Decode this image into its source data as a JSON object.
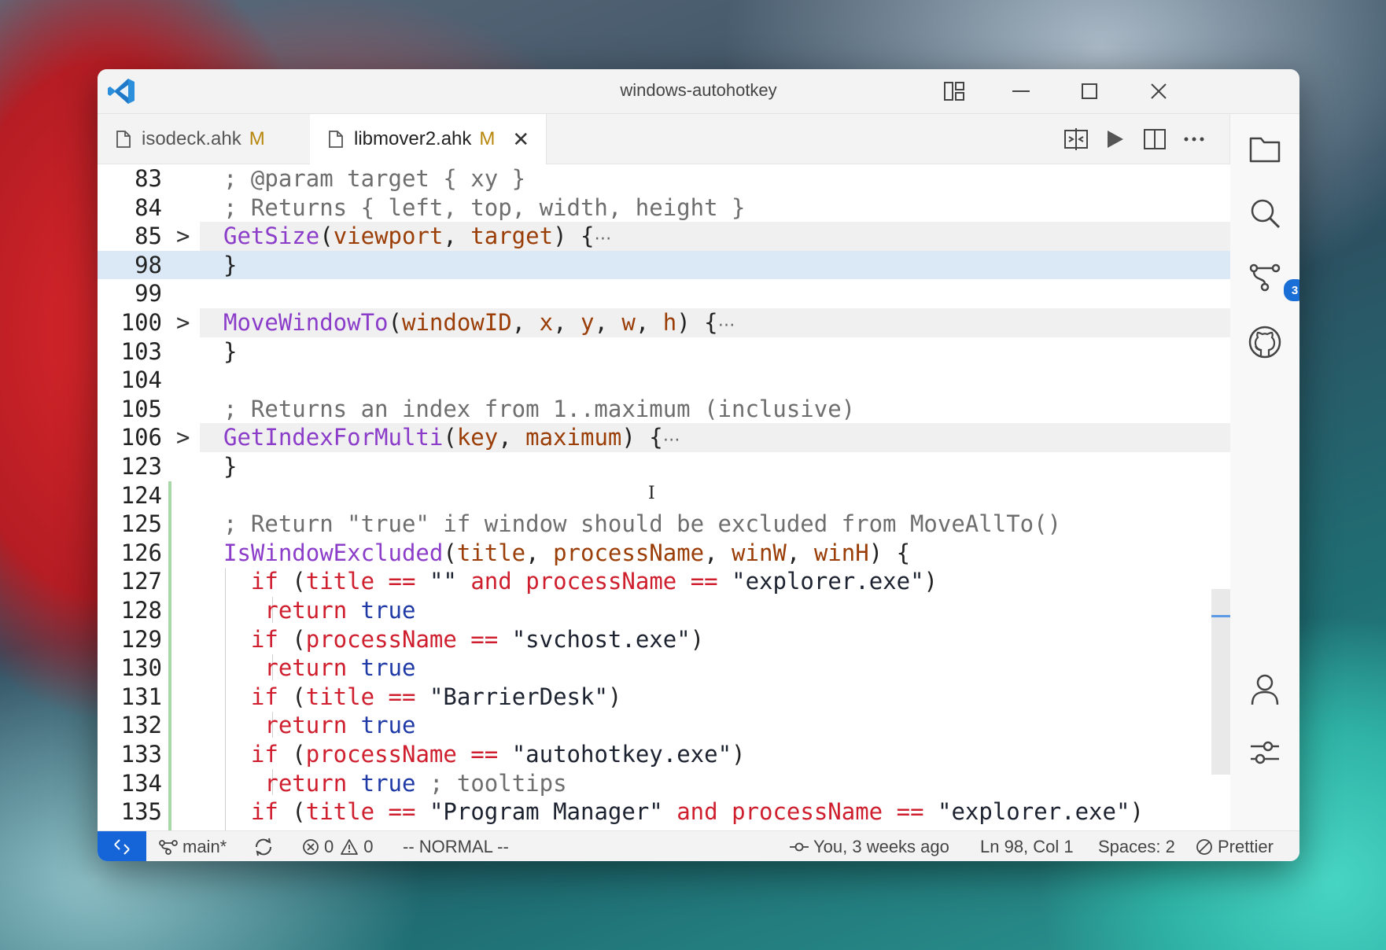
{
  "window": {
    "title": "windows-autohotkey"
  },
  "tabs": [
    {
      "label": "isodeck.ahk",
      "status": "M",
      "active": false
    },
    {
      "label": "libmover2.ahk",
      "status": "M",
      "active": true,
      "close": "✕"
    }
  ],
  "editor_actions": [
    "compare-icon",
    "run-icon",
    "split-editor-icon",
    "more-icon"
  ],
  "activity_bar": {
    "items": [
      "explorer-icon",
      "search-icon",
      "source-control-icon",
      "github-icon"
    ],
    "source_control_badge": "3",
    "bottom_items": [
      "account-icon",
      "settings-icon"
    ]
  },
  "code_lines": [
    {
      "num": "83"
    },
    {
      "num": "84"
    },
    {
      "num": "85",
      "fold": ">"
    },
    {
      "num": "98"
    },
    {
      "num": "99"
    },
    {
      "num": "100",
      "fold": ">"
    },
    {
      "num": "103"
    },
    {
      "num": "104"
    },
    {
      "num": "105"
    },
    {
      "num": "106",
      "fold": ">"
    },
    {
      "num": "123"
    },
    {
      "num": "124"
    },
    {
      "num": "125"
    },
    {
      "num": "126"
    },
    {
      "num": "127"
    },
    {
      "num": "128"
    },
    {
      "num": "129"
    },
    {
      "num": "130"
    },
    {
      "num": "131"
    },
    {
      "num": "132"
    },
    {
      "num": "133"
    },
    {
      "num": "134"
    },
    {
      "num": "135"
    }
  ],
  "code": {
    "l83": "; @param target { xy }",
    "l84": "; Returns { left, top, width, height }",
    "l85_fn": "GetSize",
    "l85_p1": "viewport",
    "l85_p2": "target",
    "l100_fn": "MoveWindowTo",
    "l100_p1": "windowID",
    "l100_p2": "x",
    "l100_p3": "y",
    "l100_p4": "w",
    "l100_p5": "h",
    "l105": "; Returns an index from 1..maximum (inclusive)",
    "l106_fn": "GetIndexForMulti",
    "l106_p1": "key",
    "l106_p2": "maximum",
    "l125": "; Return \"true\" if window should be excluded from MoveAllTo()",
    "l126_fn": "IsWindowExcluded",
    "l126_p1": "title",
    "l126_p2": "processName",
    "l126_p3": "winW",
    "l126_p4": "winH",
    "kw_if": "if",
    "kw_and": "and",
    "kw_return": "return",
    "kw_true": "true",
    "op_eq": "==",
    "v_title": "title",
    "v_processName": "processName",
    "s_empty": "\"\"",
    "s_explorer": "\"explorer.exe\"",
    "s_svchost": "\"svchost.exe\"",
    "s_barrier": "\"BarrierDesk\"",
    "s_autohotkey": "\"autohotkey.exe\"",
    "s_progman": "\"Program Manager\"",
    "c_tooltips": "; tooltips",
    "fold_ellipsis": "⋯"
  },
  "status_bar": {
    "branch": "main*",
    "errors": "0",
    "warnings": "0",
    "mode": "-- NORMAL --",
    "blame": "You, 3 weeks ago",
    "position": "Ln 98, Col 1",
    "spaces": "Spaces: 2",
    "formatter": "Prettier"
  },
  "colors": {
    "accent": "#1565d8",
    "keyword": "#cf1e2d",
    "function": "#8b3dc9",
    "parameter": "#9a3d06",
    "comment": "#6e6e6e",
    "boolean": "#1f3aa6",
    "current_line": "#dbe8f6"
  }
}
